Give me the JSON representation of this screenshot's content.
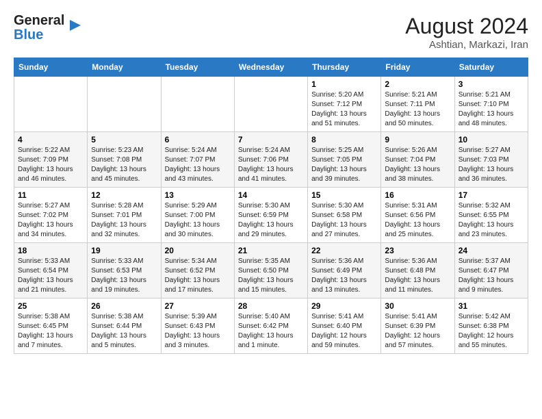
{
  "logo": {
    "line1": "General",
    "line2": "Blue"
  },
  "header": {
    "month_year": "August 2024",
    "location": "Ashtian, Markazi, Iran"
  },
  "days_of_week": [
    "Sunday",
    "Monday",
    "Tuesday",
    "Wednesday",
    "Thursday",
    "Friday",
    "Saturday"
  ],
  "weeks": [
    [
      {
        "day": "",
        "info": ""
      },
      {
        "day": "",
        "info": ""
      },
      {
        "day": "",
        "info": ""
      },
      {
        "day": "",
        "info": ""
      },
      {
        "day": "1",
        "info": "Sunrise: 5:20 AM\nSunset: 7:12 PM\nDaylight: 13 hours\nand 51 minutes."
      },
      {
        "day": "2",
        "info": "Sunrise: 5:21 AM\nSunset: 7:11 PM\nDaylight: 13 hours\nand 50 minutes."
      },
      {
        "day": "3",
        "info": "Sunrise: 5:21 AM\nSunset: 7:10 PM\nDaylight: 13 hours\nand 48 minutes."
      }
    ],
    [
      {
        "day": "4",
        "info": "Sunrise: 5:22 AM\nSunset: 7:09 PM\nDaylight: 13 hours\nand 46 minutes."
      },
      {
        "day": "5",
        "info": "Sunrise: 5:23 AM\nSunset: 7:08 PM\nDaylight: 13 hours\nand 45 minutes."
      },
      {
        "day": "6",
        "info": "Sunrise: 5:24 AM\nSunset: 7:07 PM\nDaylight: 13 hours\nand 43 minutes."
      },
      {
        "day": "7",
        "info": "Sunrise: 5:24 AM\nSunset: 7:06 PM\nDaylight: 13 hours\nand 41 minutes."
      },
      {
        "day": "8",
        "info": "Sunrise: 5:25 AM\nSunset: 7:05 PM\nDaylight: 13 hours\nand 39 minutes."
      },
      {
        "day": "9",
        "info": "Sunrise: 5:26 AM\nSunset: 7:04 PM\nDaylight: 13 hours\nand 38 minutes."
      },
      {
        "day": "10",
        "info": "Sunrise: 5:27 AM\nSunset: 7:03 PM\nDaylight: 13 hours\nand 36 minutes."
      }
    ],
    [
      {
        "day": "11",
        "info": "Sunrise: 5:27 AM\nSunset: 7:02 PM\nDaylight: 13 hours\nand 34 minutes."
      },
      {
        "day": "12",
        "info": "Sunrise: 5:28 AM\nSunset: 7:01 PM\nDaylight: 13 hours\nand 32 minutes."
      },
      {
        "day": "13",
        "info": "Sunrise: 5:29 AM\nSunset: 7:00 PM\nDaylight: 13 hours\nand 30 minutes."
      },
      {
        "day": "14",
        "info": "Sunrise: 5:30 AM\nSunset: 6:59 PM\nDaylight: 13 hours\nand 29 minutes."
      },
      {
        "day": "15",
        "info": "Sunrise: 5:30 AM\nSunset: 6:58 PM\nDaylight: 13 hours\nand 27 minutes."
      },
      {
        "day": "16",
        "info": "Sunrise: 5:31 AM\nSunset: 6:56 PM\nDaylight: 13 hours\nand 25 minutes."
      },
      {
        "day": "17",
        "info": "Sunrise: 5:32 AM\nSunset: 6:55 PM\nDaylight: 13 hours\nand 23 minutes."
      }
    ],
    [
      {
        "day": "18",
        "info": "Sunrise: 5:33 AM\nSunset: 6:54 PM\nDaylight: 13 hours\nand 21 minutes."
      },
      {
        "day": "19",
        "info": "Sunrise: 5:33 AM\nSunset: 6:53 PM\nDaylight: 13 hours\nand 19 minutes."
      },
      {
        "day": "20",
        "info": "Sunrise: 5:34 AM\nSunset: 6:52 PM\nDaylight: 13 hours\nand 17 minutes."
      },
      {
        "day": "21",
        "info": "Sunrise: 5:35 AM\nSunset: 6:50 PM\nDaylight: 13 hours\nand 15 minutes."
      },
      {
        "day": "22",
        "info": "Sunrise: 5:36 AM\nSunset: 6:49 PM\nDaylight: 13 hours\nand 13 minutes."
      },
      {
        "day": "23",
        "info": "Sunrise: 5:36 AM\nSunset: 6:48 PM\nDaylight: 13 hours\nand 11 minutes."
      },
      {
        "day": "24",
        "info": "Sunrise: 5:37 AM\nSunset: 6:47 PM\nDaylight: 13 hours\nand 9 minutes."
      }
    ],
    [
      {
        "day": "25",
        "info": "Sunrise: 5:38 AM\nSunset: 6:45 PM\nDaylight: 13 hours\nand 7 minutes."
      },
      {
        "day": "26",
        "info": "Sunrise: 5:38 AM\nSunset: 6:44 PM\nDaylight: 13 hours\nand 5 minutes."
      },
      {
        "day": "27",
        "info": "Sunrise: 5:39 AM\nSunset: 6:43 PM\nDaylight: 13 hours\nand 3 minutes."
      },
      {
        "day": "28",
        "info": "Sunrise: 5:40 AM\nSunset: 6:42 PM\nDaylight: 13 hours\nand 1 minute."
      },
      {
        "day": "29",
        "info": "Sunrise: 5:41 AM\nSunset: 6:40 PM\nDaylight: 12 hours\nand 59 minutes."
      },
      {
        "day": "30",
        "info": "Sunrise: 5:41 AM\nSunset: 6:39 PM\nDaylight: 12 hours\nand 57 minutes."
      },
      {
        "day": "31",
        "info": "Sunrise: 5:42 AM\nSunset: 6:38 PM\nDaylight: 12 hours\nand 55 minutes."
      }
    ]
  ]
}
